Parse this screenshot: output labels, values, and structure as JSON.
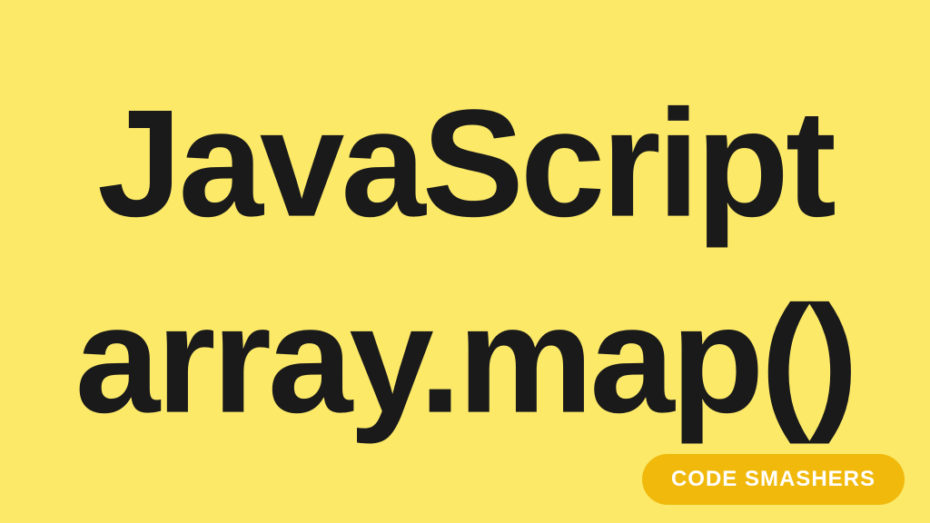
{
  "title": {
    "line1": "JavaScript",
    "line2": "array.map()"
  },
  "badge": {
    "label": "CODE SMASHERS"
  },
  "colors": {
    "background": "#fce968",
    "text": "#1a1a1a",
    "badge_bg": "#f0b90b",
    "badge_text": "#ffffff"
  }
}
